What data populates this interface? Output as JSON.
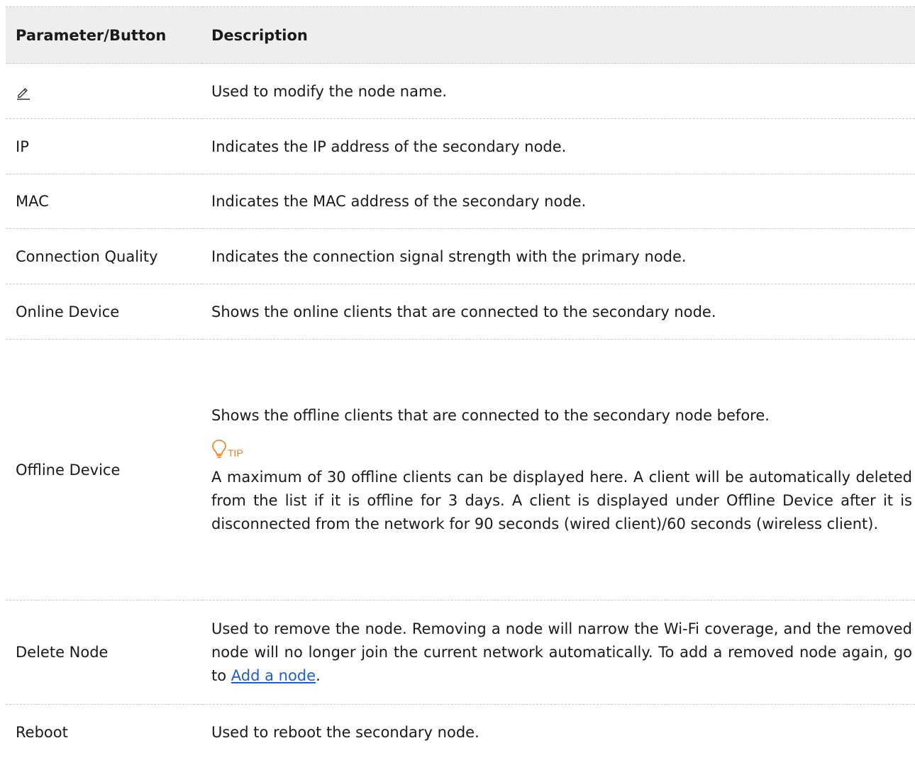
{
  "table": {
    "headers": [
      "Parameter/Button",
      "Description"
    ],
    "rows": [
      {
        "param_icon": "edit-pencil-icon",
        "description": "Used to modify the node name."
      },
      {
        "param": "IP",
        "description": "Indicates the IP address of the secondary node."
      },
      {
        "param": "MAC",
        "description": "Indicates the MAC address of the secondary node."
      },
      {
        "param": "Connection Quality",
        "description": "Indicates the connection signal strength with the primary node."
      },
      {
        "param": "Online Device",
        "description": "Shows the online clients that are connected to the secondary node."
      },
      {
        "param": "Offline Device",
        "description": "Shows the offline clients that are connected to the secondary node before.",
        "tip_icon": "lightbulb-tip-icon",
        "tip_label": "TIP",
        "tip_text": "A maximum of 30 offline clients can be displayed here. A client will be automatically deleted from the list if it is offline for 3 days. A client is displayed under Offline Device after it is disconnected from the network for 90 seconds (wired client)/60 seconds (wireless client)."
      },
      {
        "param": "Delete Node",
        "description_before_link": "Used to remove the node. Removing a node will narrow the Wi-Fi coverage, and the removed node will no longer join the current network automatically. To add a removed node again, go to ",
        "link_text": "Add a node",
        "description_after_link": "."
      },
      {
        "param": "Reboot",
        "description": "Used to reboot the secondary node."
      }
    ]
  },
  "colors": {
    "header_bg": "#eeeeee",
    "tip_accent": "#f07b1d",
    "link": "#1f5fc6",
    "divider": "#c9c9c9"
  }
}
